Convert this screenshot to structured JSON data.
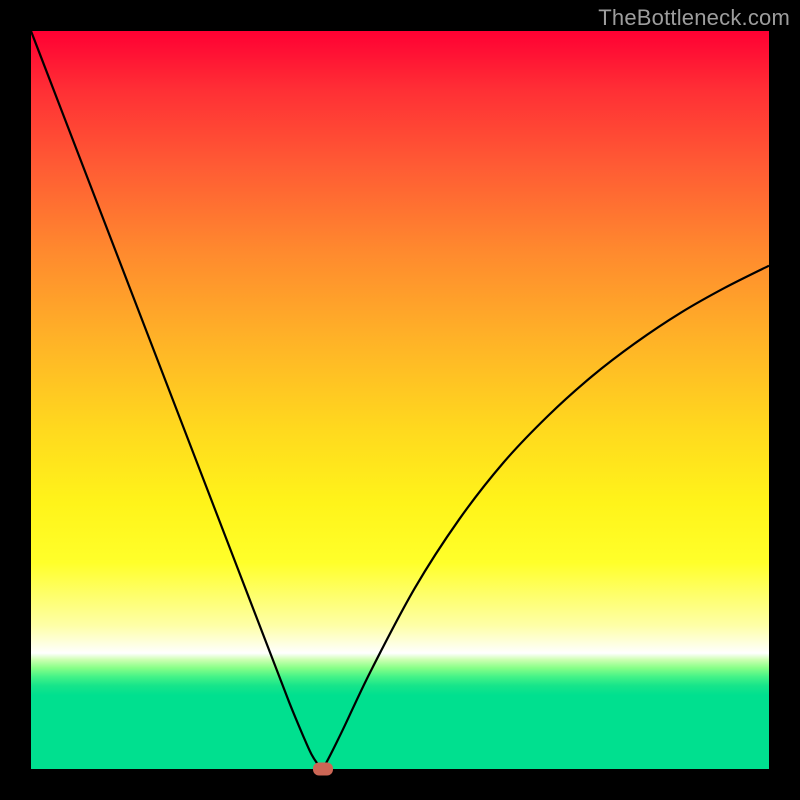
{
  "watermark": "TheBottleneck.com",
  "colors": {
    "frame": "#000000",
    "curve": "#000000",
    "marker": "#cc6655",
    "gradient_top": "#ff0033",
    "gradient_bottom": "#00e08f"
  },
  "chart_data": {
    "type": "line",
    "title": "",
    "xlabel": "",
    "ylabel": "",
    "xlim": [
      0,
      100
    ],
    "ylim": [
      0,
      100
    ],
    "x": [
      0,
      4,
      8,
      12,
      16,
      20,
      24,
      28,
      32,
      35,
      37,
      38,
      38.9,
      39.5,
      42,
      46,
      52,
      58,
      64,
      70,
      76,
      82,
      88,
      94,
      100
    ],
    "values": [
      100,
      89.6,
      79.2,
      68.8,
      58.4,
      48,
      37.6,
      27.2,
      16.8,
      9,
      4.2,
      2.0,
      0.6,
      0,
      4.8,
      13.2,
      24.5,
      33.8,
      41.5,
      47.8,
      53.2,
      57.8,
      61.8,
      65.2,
      68.2
    ],
    "minimum_marker": {
      "x": 39.5,
      "y": 0
    }
  }
}
